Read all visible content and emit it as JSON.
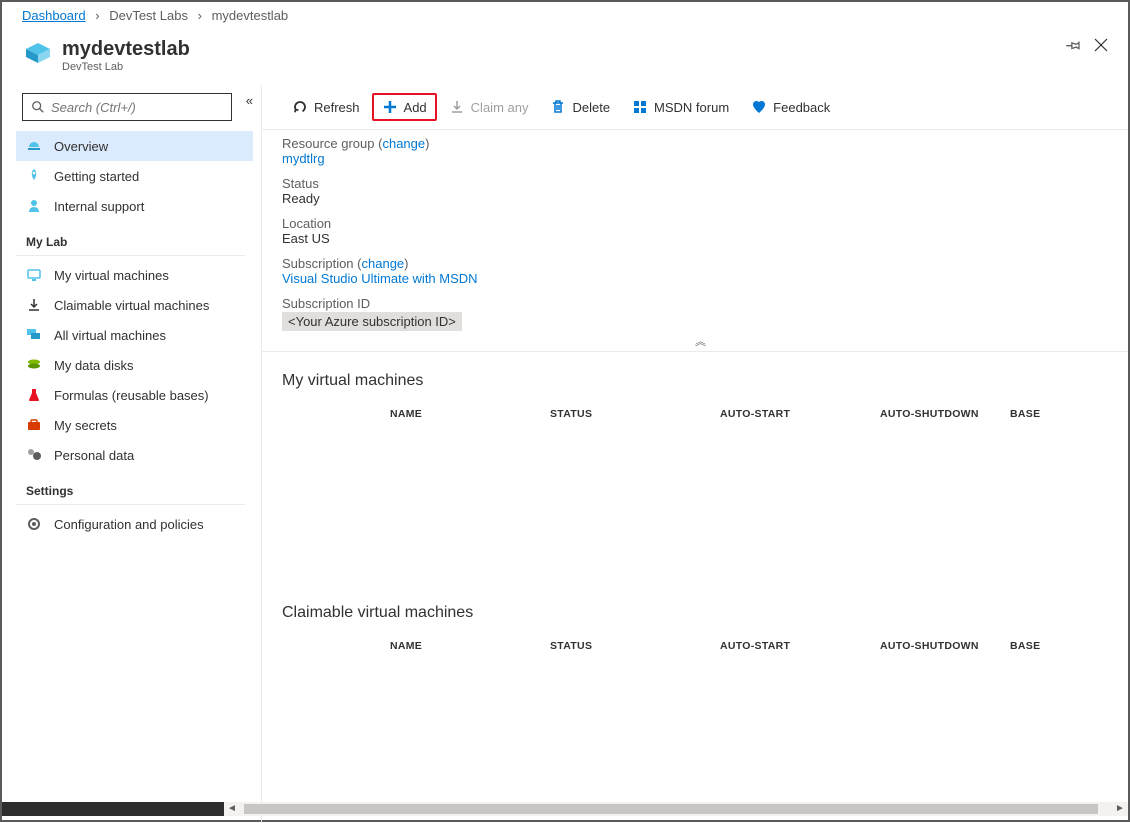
{
  "breadcrumb": {
    "dashboard": "Dashboard",
    "devtest_labs": "DevTest Labs",
    "current": "mydevtestlab"
  },
  "header": {
    "title": "mydevtestlab",
    "subtitle": "DevTest Lab"
  },
  "search": {
    "placeholder": "Search (Ctrl+/)"
  },
  "sidebar": {
    "overview": "Overview",
    "getting_started": "Getting started",
    "internal_support": "Internal support",
    "my_lab_section": "My Lab",
    "my_vms": "My virtual machines",
    "claimable_vms": "Claimable virtual machines",
    "all_vms": "All virtual machines",
    "my_data_disks": "My data disks",
    "formulas": "Formulas (reusable bases)",
    "my_secrets": "My secrets",
    "personal_data": "Personal data",
    "settings_section": "Settings",
    "config_policies": "Configuration and policies"
  },
  "toolbar": {
    "refresh": "Refresh",
    "add": "Add",
    "claim_any": "Claim any",
    "delete": "Delete",
    "msdn_forum": "MSDN forum",
    "feedback": "Feedback"
  },
  "details": {
    "resource_group_label": "Resource group",
    "change": "change",
    "resource_group_value": "mydtlrg",
    "status_label": "Status",
    "status_value": "Ready",
    "location_label": "Location",
    "location_value": "East US",
    "subscription_label": "Subscription",
    "subscription_value": "Visual Studio Ultimate with MSDN",
    "subscription_id_label": "Subscription ID",
    "subscription_id_value": "<Your Azure subscription ID>"
  },
  "sections": {
    "my_vms_title": "My virtual machines",
    "claimable_vms_title": "Claimable virtual machines",
    "columns": {
      "name": "NAME",
      "status": "STATUS",
      "auto_start": "AUTO-START",
      "auto_shutdown": "AUTO-SHUTDOWN",
      "base": "BASE"
    }
  }
}
